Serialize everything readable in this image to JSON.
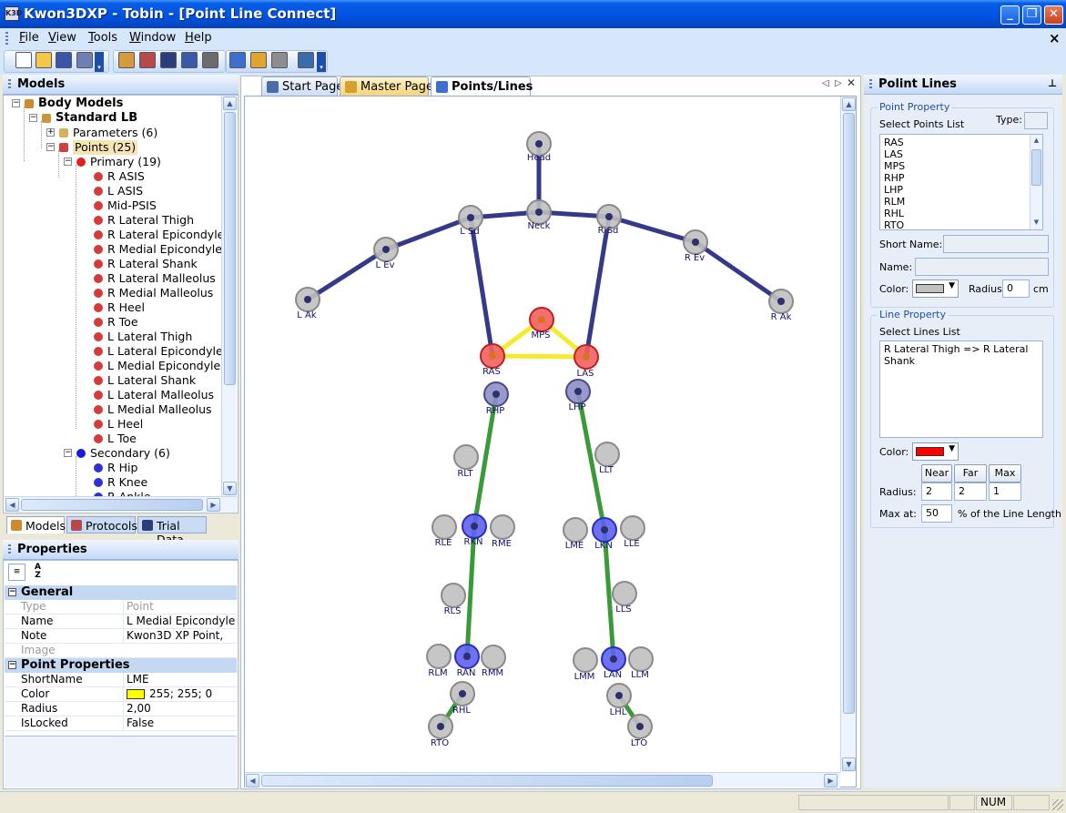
{
  "window": {
    "title": "Kwon3DXP - Tobin - [Point Line Connect]",
    "app_icon": "K3D"
  },
  "menu": [
    {
      "label": "File",
      "key": "F",
      "rest": "ile"
    },
    {
      "label": "View",
      "key": "V",
      "rest": "iew"
    },
    {
      "label": "Tools",
      "key": "T",
      "rest": "ools"
    },
    {
      "label": "Window",
      "key": "W",
      "rest": "indow"
    },
    {
      "label": "Help",
      "key": "H",
      "rest": "elp"
    }
  ],
  "toolbar_icons": [
    "new-file-icon",
    "open-folder-icon",
    "save-icon",
    "save-all-icon",
    "body-model-icon",
    "edit-protocol-icon",
    "film-icon",
    "notebook-icon",
    "wizard-icon",
    "point-line-icon",
    "master-page-icon",
    "camera-icon",
    "digitize-icon"
  ],
  "models_panel": {
    "title": "Models",
    "tree": [
      {
        "label": "Body Models",
        "depth": 0,
        "bold": true,
        "expander": "-",
        "icon": "body-models-icon"
      },
      {
        "label": "Standard LB",
        "depth": 1,
        "bold": true,
        "expander": "-",
        "icon": "standard-model-icon"
      },
      {
        "label": "Parameters (6)",
        "depth": 2,
        "expander": "+",
        "icon": "ruler-icon"
      },
      {
        "label": "Points (25)",
        "depth": 2,
        "expander": "-",
        "icon": "points-icon",
        "selected": true
      },
      {
        "label": "Primary (19)",
        "depth": 3,
        "expander": "-",
        "icon": "red-dot-icon"
      },
      {
        "label": "R ASIS",
        "depth": 4,
        "icon": "red-point-icon"
      },
      {
        "label": "L ASIS",
        "depth": 4,
        "icon": "red-point-icon"
      },
      {
        "label": "Mid-PSIS",
        "depth": 4,
        "icon": "red-point-icon"
      },
      {
        "label": "R Lateral Thigh",
        "depth": 4,
        "icon": "red-point-icon"
      },
      {
        "label": "R Lateral Epicondyle",
        "depth": 4,
        "icon": "red-point-icon"
      },
      {
        "label": "R Medial Epicondyle",
        "depth": 4,
        "icon": "red-point-icon"
      },
      {
        "label": "R Lateral Shank",
        "depth": 4,
        "icon": "red-point-icon"
      },
      {
        "label": "R Lateral Malleolus",
        "depth": 4,
        "icon": "red-point-icon"
      },
      {
        "label": "R Medial Malleolus",
        "depth": 4,
        "icon": "red-point-icon"
      },
      {
        "label": "R Heel",
        "depth": 4,
        "icon": "red-point-icon"
      },
      {
        "label": "R Toe",
        "depth": 4,
        "icon": "red-point-icon"
      },
      {
        "label": "L Lateral Thigh",
        "depth": 4,
        "icon": "red-point-icon"
      },
      {
        "label": "L Lateral Epicondyle",
        "depth": 4,
        "icon": "red-point-icon"
      },
      {
        "label": "L Medial Epicondyle",
        "depth": 4,
        "icon": "red-point-icon"
      },
      {
        "label": "L Lateral Shank",
        "depth": 4,
        "icon": "red-point-icon"
      },
      {
        "label": "L Lateral Malleolus",
        "depth": 4,
        "icon": "red-point-icon"
      },
      {
        "label": "L Medial Malleolus",
        "depth": 4,
        "icon": "red-point-icon"
      },
      {
        "label": "L Heel",
        "depth": 4,
        "icon": "red-point-icon"
      },
      {
        "label": "L Toe",
        "depth": 4,
        "icon": "red-point-icon"
      },
      {
        "label": "Secondary (6)",
        "depth": 3,
        "expander": "-",
        "icon": "blue-dot-icon"
      },
      {
        "label": "R Hip",
        "depth": 4,
        "icon": "blue-point-icon"
      },
      {
        "label": "R Knee",
        "depth": 4,
        "icon": "blue-point-icon"
      },
      {
        "label": "R Ankle",
        "depth": 4,
        "icon": "blue-point-icon"
      }
    ],
    "tabs": [
      "Models",
      "Protocols",
      "Trial Data"
    ]
  },
  "properties": {
    "title": "Properties",
    "categories": [
      {
        "name": "General",
        "rows": [
          {
            "name": "Type",
            "value": "Point",
            "dim": true
          },
          {
            "name": "Name",
            "value": "L Medial Epicondyle"
          },
          {
            "name": "Note",
            "value": "Kwon3D XP Point,"
          },
          {
            "name": "Image",
            "value": "",
            "dim": true
          }
        ]
      },
      {
        "name": "Point Properties",
        "rows": [
          {
            "name": "ShortName",
            "value": "LME"
          },
          {
            "name": "Color",
            "value": "255; 255; 0",
            "swatch": "#ffff00"
          },
          {
            "name": "Radius",
            "value": "2,00"
          },
          {
            "name": "IsLocked",
            "value": "False"
          }
        ]
      }
    ]
  },
  "doc_tabs": [
    "Start Page",
    "Master Page",
    "Points/Lines"
  ],
  "skeleton": {
    "lines": [
      {
        "a": "Head",
        "b": "Neck",
        "color": "#36388a"
      },
      {
        "a": "L Ak",
        "b": "L Ev",
        "color": "#36388a"
      },
      {
        "a": "L Ev",
        "b": "L Sd",
        "color": "#36388a"
      },
      {
        "a": "L Sd",
        "b": "Neck",
        "color": "#36388a"
      },
      {
        "a": "Neck",
        "b": "R Sd",
        "color": "#36388a"
      },
      {
        "a": "R Sd",
        "b": "R Ev",
        "color": "#36388a"
      },
      {
        "a": "R Ev",
        "b": "R Ak",
        "color": "#36388a"
      },
      {
        "a": "L Sd",
        "b": "RAS",
        "color": "#36388a"
      },
      {
        "a": "R Sd",
        "b": "LAS",
        "color": "#36388a"
      },
      {
        "a": "RAS",
        "b": "LAS",
        "color": "#f2ec2c"
      },
      {
        "a": "RAS",
        "b": "MPS",
        "color": "#f2ec2c"
      },
      {
        "a": "MPS",
        "b": "LAS",
        "color": "#f2ec2c"
      },
      {
        "a": "RHP",
        "b": "RKN",
        "color": "#3a9a3a"
      },
      {
        "a": "RKN",
        "b": "RAN",
        "color": "#3a9a3a"
      },
      {
        "a": "RHL",
        "b": "RTO",
        "color": "#3a9a3a"
      },
      {
        "a": "LHP",
        "b": "LKN",
        "color": "#3a9a3a"
      },
      {
        "a": "LKN",
        "b": "LAN",
        "color": "#3a9a3a"
      },
      {
        "a": "LHL",
        "b": "LTO",
        "color": "#3a9a3a"
      }
    ],
    "points": [
      {
        "label": "Head",
        "kind": "gray",
        "anchored": true
      },
      {
        "label": "Neck",
        "kind": "gray",
        "anchored": true
      },
      {
        "label": "L Sd",
        "kind": "gray",
        "anchored": true
      },
      {
        "label": "R Sd",
        "kind": "gray",
        "anchored": true
      },
      {
        "label": "L Ev",
        "kind": "gray",
        "anchored": true
      },
      {
        "label": "R Ev",
        "kind": "gray",
        "anchored": true
      },
      {
        "label": "L Ak",
        "kind": "gray",
        "anchored": true
      },
      {
        "label": "R Ak",
        "kind": "gray",
        "anchored": true
      },
      {
        "label": "MPS",
        "kind": "red",
        "anchored": true
      },
      {
        "label": "RAS",
        "kind": "red",
        "anchored": true
      },
      {
        "label": "LAS",
        "kind": "red",
        "anchored": true
      },
      {
        "label": "RHP",
        "kind": "purple",
        "anchored": true
      },
      {
        "label": "LHP",
        "kind": "purple",
        "anchored": true
      },
      {
        "label": "RLT",
        "kind": "gray"
      },
      {
        "label": "LLT",
        "kind": "gray"
      },
      {
        "label": "RLE",
        "kind": "gray"
      },
      {
        "label": "RKN",
        "kind": "blue",
        "anchored": true
      },
      {
        "label": "RME",
        "kind": "gray"
      },
      {
        "label": "LME",
        "kind": "gray"
      },
      {
        "label": "LKN",
        "kind": "blue",
        "anchored": true
      },
      {
        "label": "LLE",
        "kind": "gray"
      },
      {
        "label": "RLS",
        "kind": "gray"
      },
      {
        "label": "LLS",
        "kind": "gray"
      },
      {
        "label": "RLM",
        "kind": "gray"
      },
      {
        "label": "RAN",
        "kind": "blue",
        "anchored": true
      },
      {
        "label": "RMM",
        "kind": "gray"
      },
      {
        "label": "LMM",
        "kind": "gray"
      },
      {
        "label": "LAN",
        "kind": "blue",
        "anchored": true
      },
      {
        "label": "LLM",
        "kind": "gray"
      },
      {
        "label": "RHL",
        "kind": "gray",
        "anchored": true
      },
      {
        "label": "LHL",
        "kind": "gray",
        "anchored": true
      },
      {
        "label": "RTO",
        "kind": "gray",
        "anchored": true
      },
      {
        "label": "LTO",
        "kind": "gray",
        "anchored": true
      }
    ],
    "colors": {
      "gray": "#c0c0c0",
      "red": "#f06060",
      "purple": "#8e8ec4",
      "blue": "#5e62ee",
      "anchor": "#2e2f6e"
    }
  },
  "right_panel": {
    "title": "Polint Lines",
    "point_property": {
      "group_title": "Point Property",
      "select_label": "Select Points List",
      "type_label": "Type:",
      "points_list": [
        "RAS",
        "LAS",
        "MPS",
        "RHP",
        "LHP",
        "RLM",
        "RHL",
        "RTO"
      ],
      "short_name_label": "Short Name:",
      "name_label": "Name:",
      "color_label": "Color:",
      "color_value": "#c0c0c0",
      "radius_label": "Radius:",
      "radius_value": "0",
      "radius_unit": "cm"
    },
    "line_property": {
      "group_title": "Line Property",
      "select_label": "Select Lines List",
      "lines_list": [
        "R Lateral Thigh => R Lateral Shank"
      ],
      "color_label": "Color:",
      "color_value": "#ff0000",
      "near_label": "Near",
      "far_label": "Far",
      "max_label": "Max",
      "radius_label": "Radius:",
      "near_value": "2",
      "far_value": "2",
      "max_value": "1",
      "maxat_label": "Max at:",
      "maxat_value": "50",
      "maxat_suffix": "% of the Line Length"
    }
  },
  "status": {
    "num": "NUM"
  }
}
